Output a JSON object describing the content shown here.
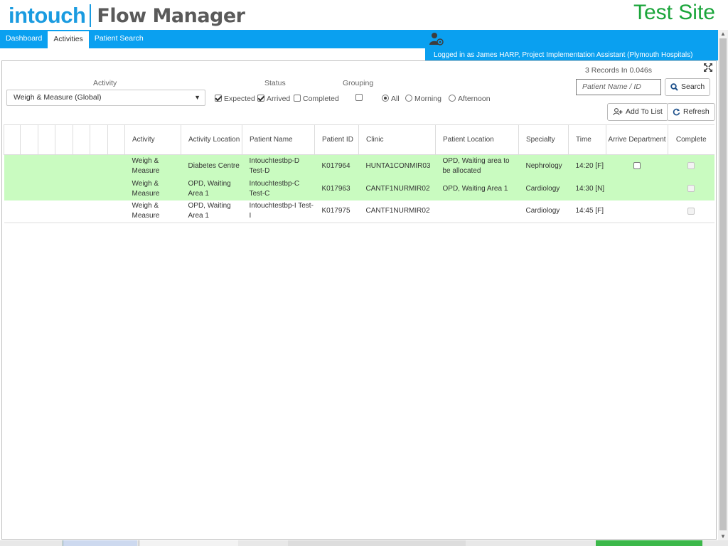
{
  "app": {
    "logo_primary": "intouch",
    "logo_secondary": "Flow Manager",
    "site_label": "Test Site",
    "colors": {
      "accent": "#0aa0f0",
      "logo_blue": "#1a9be0",
      "site_green": "#1aa53a",
      "row_green": "#c9fbc0"
    }
  },
  "nav": {
    "tabs": [
      {
        "label": "Dashboard",
        "active": false
      },
      {
        "label": "Activities",
        "active": true
      },
      {
        "label": "Patient Search",
        "active": false
      }
    ],
    "user_icon": "user-settings-icon",
    "logged_in": "Logged in as James HARP, Project Implementation Assistant (Plymouth Hospitals)"
  },
  "toolbar": {
    "records": "3 Records In 0.046s",
    "expand_icon": "expand-icon",
    "activity_label": "Activity",
    "activity_value": "Weigh & Measure (Global)",
    "status_label": "Status",
    "status_options": [
      {
        "label": "Expected",
        "checked": true
      },
      {
        "label": "Arrived",
        "checked": true
      },
      {
        "label": "Completed",
        "checked": false
      }
    ],
    "grouping_label": "Grouping",
    "grouping_checked": false,
    "grouping_options": [
      {
        "label": "All",
        "checked": true
      },
      {
        "label": "Morning",
        "checked": false
      },
      {
        "label": "Afternoon",
        "checked": false
      }
    ],
    "search_placeholder": "Patient Name / ID",
    "search_label": "Search",
    "add_label": "Add To List",
    "refresh_label": "Refresh"
  },
  "table": {
    "columns": [
      "Activity",
      "Activity Location",
      "Patient Name",
      "Patient ID",
      "Clinic",
      "Patient Location",
      "Specialty",
      "Time",
      "Arrive Department",
      "Complete"
    ],
    "rows": [
      {
        "activity": "Weigh & Measure",
        "location": "Diabetes Centre",
        "patient_name": "Intouchtestbp-D Test-D",
        "patient_id": "K017964",
        "clinic": "HUNTA1CONMIR03",
        "patient_location": "OPD, Waiting area to be allocated",
        "specialty": "Nephrology",
        "time": "14:20 [F]",
        "arrive": true,
        "highlight": true
      },
      {
        "activity": "Weigh & Measure",
        "location": "OPD, Waiting Area 1",
        "patient_name": "Intouchtestbp-C Test-C",
        "patient_id": "K017963",
        "clinic": "CANTF1NURMIR02",
        "patient_location": "OPD, Waiting Area 1",
        "specialty": "Cardiology",
        "time": "14:30 [N]",
        "arrive": false,
        "highlight": true
      },
      {
        "activity": "Weigh & Measure",
        "location": "OPD, Waiting Area 1",
        "patient_name": "Intouchtestbp-I Test-I",
        "patient_id": "K017975",
        "clinic": "CANTF1NURMIR02",
        "patient_location": "",
        "specialty": "Cardiology",
        "time": "14:45 [F]",
        "arrive": false,
        "highlight": false
      }
    ]
  }
}
